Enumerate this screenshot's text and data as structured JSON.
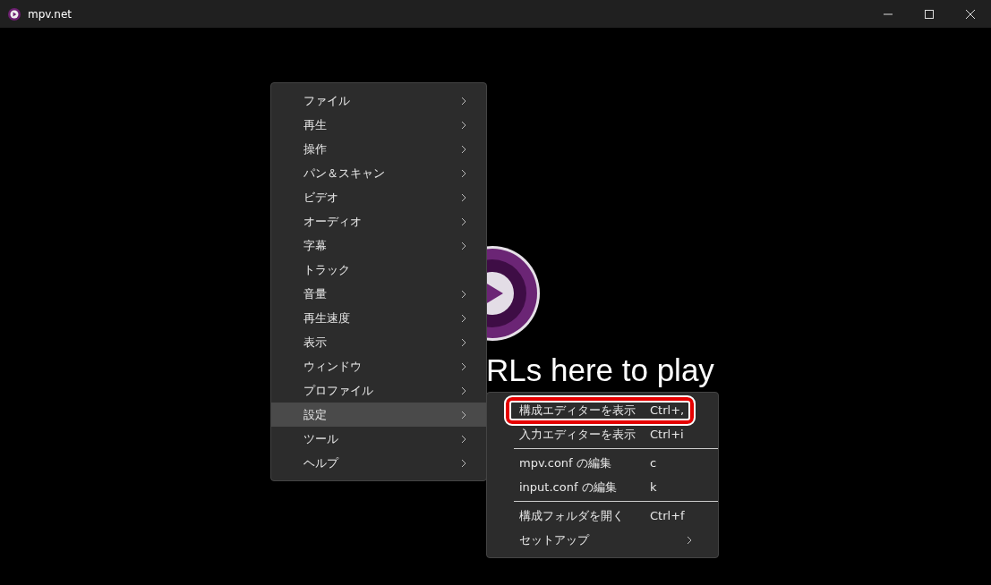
{
  "window": {
    "title": "mpv.net"
  },
  "background": {
    "hint": "RLs here to play"
  },
  "menu": {
    "items": [
      {
        "label": "ファイル",
        "has_submenu": true,
        "selected": false
      },
      {
        "label": "再生",
        "has_submenu": true,
        "selected": false
      },
      {
        "label": "操作",
        "has_submenu": true,
        "selected": false
      },
      {
        "label": "パン＆スキャン",
        "has_submenu": true,
        "selected": false
      },
      {
        "label": "ビデオ",
        "has_submenu": true,
        "selected": false
      },
      {
        "label": "オーディオ",
        "has_submenu": true,
        "selected": false
      },
      {
        "label": "字幕",
        "has_submenu": true,
        "selected": false
      },
      {
        "label": "トラック",
        "has_submenu": false,
        "selected": false
      },
      {
        "label": "音量",
        "has_submenu": true,
        "selected": false
      },
      {
        "label": "再生速度",
        "has_submenu": true,
        "selected": false
      },
      {
        "label": "表示",
        "has_submenu": true,
        "selected": false
      },
      {
        "label": "ウィンドウ",
        "has_submenu": true,
        "selected": false
      },
      {
        "label": "プロファイル",
        "has_submenu": true,
        "selected": false
      },
      {
        "label": "設定",
        "has_submenu": true,
        "selected": true
      },
      {
        "label": "ツール",
        "has_submenu": true,
        "selected": false
      },
      {
        "label": "ヘルプ",
        "has_submenu": true,
        "selected": false
      }
    ]
  },
  "submenu": {
    "items": [
      {
        "kind": "item",
        "label": "構成エディターを表示",
        "shortcut": "Ctrl+,",
        "has_submenu": false,
        "highlighted": true
      },
      {
        "kind": "item",
        "label": "入力エディターを表示",
        "shortcut": "Ctrl+i",
        "has_submenu": false,
        "highlighted": false
      },
      {
        "kind": "separator"
      },
      {
        "kind": "item",
        "label": "mpv.conf の編集",
        "shortcut": "c",
        "has_submenu": false,
        "highlighted": false
      },
      {
        "kind": "item",
        "label": "input.conf の編集",
        "shortcut": "k",
        "has_submenu": false,
        "highlighted": false
      },
      {
        "kind": "separator"
      },
      {
        "kind": "item",
        "label": "構成フォルダを開く",
        "shortcut": "Ctrl+f",
        "has_submenu": false,
        "highlighted": false
      },
      {
        "kind": "item",
        "label": "セットアップ",
        "has_submenu": true,
        "highlighted": false
      }
    ]
  }
}
